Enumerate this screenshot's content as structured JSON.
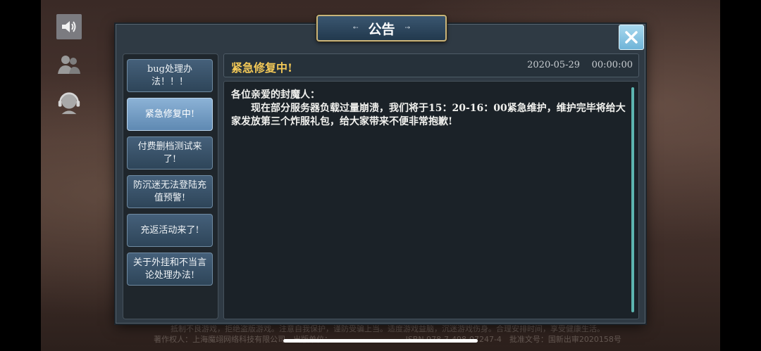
{
  "dialog": {
    "title": "公告",
    "close_icon": "close-icon"
  },
  "sidebar_icons": [
    "speaker-icon",
    "friends-icon",
    "customer-service-icon"
  ],
  "notices": [
    {
      "label": "bug处理办法！！！"
    },
    {
      "label": "紧急修复中!",
      "active": true
    },
    {
      "label": "付费删档测试来了!"
    },
    {
      "label": "防沉迷无法登陆充值预警!"
    },
    {
      "label": "充返活动来了!"
    },
    {
      "label": "关于外挂和不当言论处理办法!"
    }
  ],
  "notice_detail": {
    "title": "紧急修复中!",
    "date": "2020-05-29",
    "time": "00:00:00",
    "greeting": "各位亲爱的封魔人：",
    "body": "现在部分服务器负载过量崩溃，我们将于15：20-16：00紧急维护，维护完毕将给大家发放第三个炸服礼包，给大家带来不便非常抱歉!"
  },
  "colors": {
    "accent_gold": "#f2c857",
    "active_item": "#8cb2d6",
    "scrollbar": "#5cb5b0"
  }
}
